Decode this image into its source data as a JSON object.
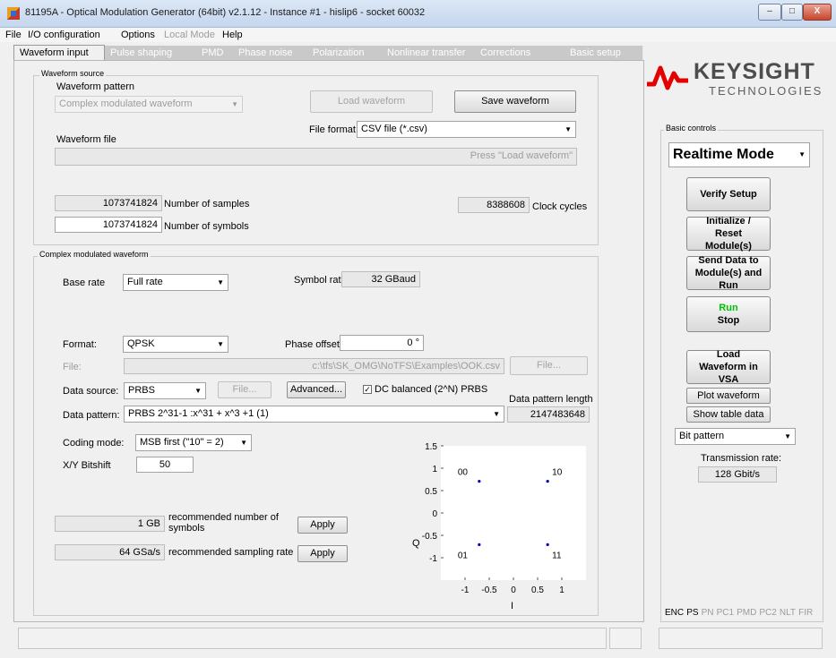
{
  "window": {
    "title": "81195A - Optical Modulation Generator (64bit) v2.1.12 - Instance #1 - hislip6 - socket 60032",
    "controls": [
      "–",
      "□",
      "X"
    ]
  },
  "menu": [
    "File",
    "I/O configuration",
    "Options",
    "Local Mode",
    "Help"
  ],
  "tabs": [
    "Waveform input",
    "Pulse shaping",
    "PMD",
    "Phase noise",
    "Polarization",
    "Nonlinear transfer",
    "Corrections",
    "Basic setup"
  ],
  "waveform_source": {
    "legend": "Waveform source",
    "pattern_label": "Waveform pattern",
    "pattern_value": "Complex modulated waveform",
    "load_button": "Load waveform",
    "save_button": "Save waveform",
    "file_format_label": "File format",
    "file_format_value": "CSV file (*.csv)",
    "file_label": "Waveform file",
    "file_placeholder": "Press \"Load waveform\"",
    "samples_value": "1073741824",
    "samples_label": "Number of samples",
    "symbols_value": "1073741824",
    "symbols_label": "Number of symbols",
    "clock_value": "8388608",
    "clock_label": "Clock cycles"
  },
  "complex": {
    "legend": "Complex modulated waveform",
    "base_rate_label": "Base rate",
    "base_rate_value": "Full rate",
    "symbol_rate_label": "Symbol rate",
    "symbol_rate_value": "32 GBaud",
    "format_label": "Format:",
    "format_value": "QPSK",
    "phase_offset_label": "Phase offset:",
    "phase_offset_value": "0 °",
    "file_label": "File:",
    "file_value": "c:\\tfs\\SK_OMG\\NoTFS\\Examples\\OOK.csv",
    "file_button": "File...",
    "data_source_label": "Data source:",
    "data_source_value": "PRBS",
    "data_source_file_button": "File...",
    "advanced_button": "Advanced...",
    "dc_balanced_label": "DC balanced (2^N) PRBS",
    "dc_balanced_checked": true,
    "data_pattern_length_label": "Data pattern length",
    "data_pattern_label": "Data pattern:",
    "data_pattern_value": "PRBS 2^31-1  :x^31 + x^3 +1    (1)",
    "data_pattern_length_value": "2147483648",
    "coding_mode_label": "Coding mode:",
    "coding_mode_value": "MSB first (\"10\" = 2)",
    "xy_bitshift_label": "X/Y Bitshift",
    "xy_bitshift_value": "50",
    "rec_symbols_value": "1 GB",
    "rec_symbols_label": "recommended number of symbols",
    "rec_symbols_apply": "Apply",
    "rec_rate_value": "64 GSa/s",
    "rec_rate_label": "recommended sampling rate",
    "rec_rate_apply": "Apply"
  },
  "chart_data": {
    "type": "scatter",
    "xlabel": "I",
    "ylabel": "Q",
    "xlim": [
      -1.5,
      1.5
    ],
    "ylim": [
      -1.5,
      1.5
    ],
    "x_ticks": [
      "-1",
      "-0.5",
      "0",
      "0.5",
      "1"
    ],
    "y_ticks": [
      "1.5",
      "1",
      "0.5",
      "0",
      "-0.5",
      "-1"
    ],
    "points": [
      {
        "x": -0.707,
        "y": 0.707,
        "label": "00"
      },
      {
        "x": 0.707,
        "y": 0.707,
        "label": "10"
      },
      {
        "x": -0.707,
        "y": -0.707,
        "label": "01"
      },
      {
        "x": 0.707,
        "y": -0.707,
        "label": "11"
      }
    ],
    "point_color": "#0000cc"
  },
  "logo": {
    "name": "KEYSIGHT",
    "sub": "TECHNOLOGIES"
  },
  "basic_controls": {
    "legend": "Basic controls",
    "mode_value": "Realtime Mode",
    "verify_button": "Verify Setup",
    "init_button": "Initialize / Reset Module(s)",
    "send_button": "Send Data to Module(s) and Run",
    "run_label": "Run",
    "stop_label": "Stop",
    "load_vsa_button": "Load Waveform in VSA",
    "plot_button": "Plot waveform",
    "table_button": "Show table data",
    "view_value": "Bit pattern",
    "transmission_label": "Transmission rate:",
    "transmission_value": "128 Gbit/s",
    "run_color": "#00c000"
  },
  "mode_tags": {
    "active": [
      "ENC",
      "PS"
    ],
    "inactive": [
      "PN",
      "PC1",
      "PMD",
      "PC2",
      "NLT",
      "FIR"
    ]
  }
}
